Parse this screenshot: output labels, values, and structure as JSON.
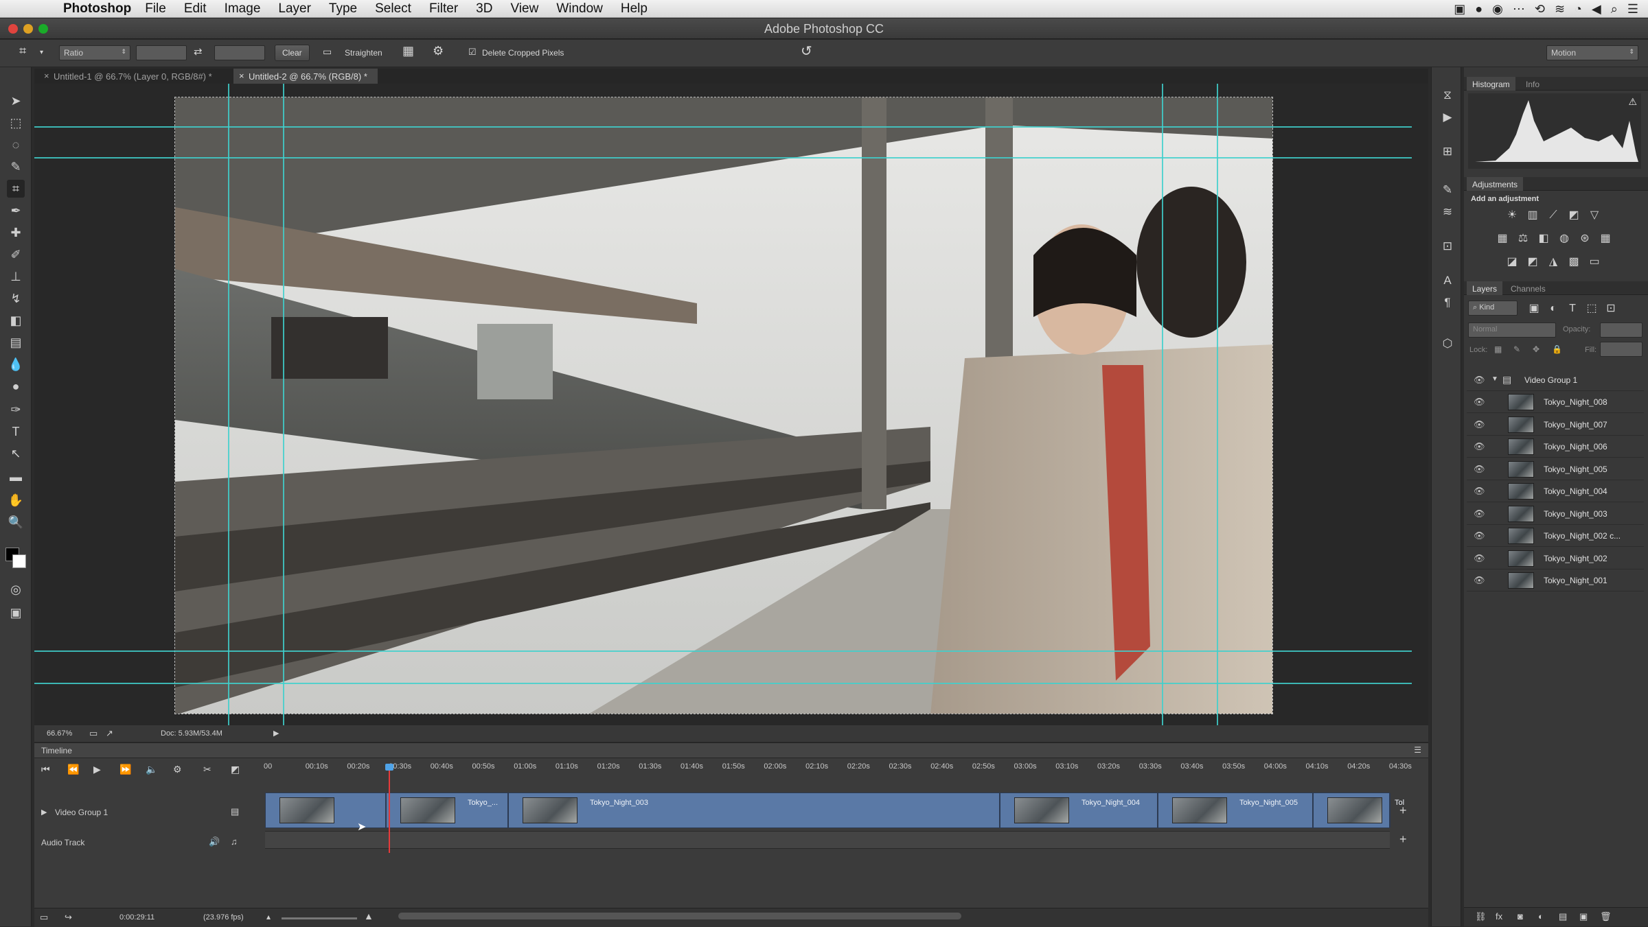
{
  "menubar": {
    "app_name": "Photoshop",
    "items": [
      "File",
      "Edit",
      "Image",
      "Layer",
      "Type",
      "Select",
      "Filter",
      "3D",
      "View",
      "Window",
      "Help"
    ]
  },
  "window": {
    "title": "Adobe Photoshop CC"
  },
  "options_bar": {
    "ratio_label": "Ratio",
    "clear_label": "Clear",
    "straighten_label": "Straighten",
    "delete_cropped_label": "Delete Cropped Pixels",
    "workspace_label": "Motion"
  },
  "doc_tabs": [
    {
      "label": "Untitled-1 @ 66.7% (Layer 0, RGB/8#) *"
    },
    {
      "label": "Untitled-2 @ 66.7% (RGB/8) *"
    }
  ],
  "status": {
    "zoom": "66.67%",
    "doc": "Doc: 5.93M/53.4M"
  },
  "timeline": {
    "label": "Timeline",
    "ruler": [
      "00",
      "00:10s",
      "00:20s",
      "00:30s",
      "00:40s",
      "00:50s",
      "01:00s",
      "01:10s",
      "01:20s",
      "01:30s",
      "01:40s",
      "01:50s",
      "02:00s",
      "02:10s",
      "02:20s",
      "02:30s",
      "02:40s",
      "02:50s",
      "03:00s",
      "03:10s",
      "03:20s",
      "03:30s",
      "03:40s",
      "03:50s",
      "04:00s",
      "04:10s",
      "04:20s",
      "04:30s"
    ],
    "video_group_label": "Video Group 1",
    "audio_track_label": "Audio Track",
    "clips": [
      "",
      "Tokyo_...",
      "Tokyo_Night_003",
      "Tokyo_Night_004",
      "Tokyo_Night_005",
      "Tol"
    ],
    "current_time": "0:00:29:11",
    "fps": "(23.976 fps)"
  },
  "panels": {
    "histogram_tab": "Histogram",
    "info_tab": "Info",
    "adjustments_title": "Adjustments",
    "add_adjustment": "Add an adjustment",
    "layers_tab": "Layers",
    "channels_tab": "Channels",
    "kind_label": "Kind",
    "blend_mode": "Normal",
    "opacity_label": "Opacity:",
    "lock_label": "Lock:",
    "fill_label": "Fill:",
    "group_name": "Video Group 1",
    "layers": [
      "Tokyo_Night_008",
      "Tokyo_Night_007",
      "Tokyo_Night_006",
      "Tokyo_Night_005",
      "Tokyo_Night_004",
      "Tokyo_Night_003",
      "Tokyo_Night_002 c...",
      "Tokyo_Night_002",
      "Tokyo_Night_001"
    ]
  },
  "colors": {
    "guide": "#3fd0cc",
    "playhead": "#e63a3a",
    "track": "#5a79a6"
  }
}
